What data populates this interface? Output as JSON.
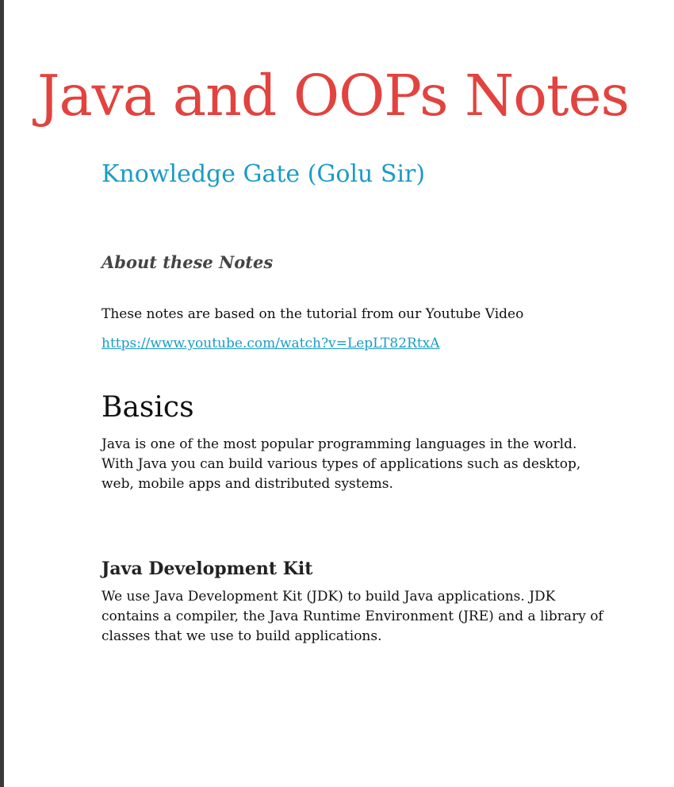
{
  "document": {
    "title": "Java and OOPs Notes",
    "subtitle": "Knowledge Gate (Golu Sir)",
    "about": {
      "heading": "About these Notes",
      "text": "These notes are based on the tutorial from our Youtube Video",
      "link": "https://www.youtube.com/watch?v=LepLT82RtxA"
    },
    "basics": {
      "heading": "Basics",
      "text": "Java is one of the most popular programming languages in the world. With Java you can build various types of applications such as desktop, web, mobile apps and distributed systems."
    },
    "jdk": {
      "heading": "Java Development Kit",
      "text": "We use Java Development Kit (JDK) to build Java applications. JDK contains a compiler, the Java Runtime Environment (JRE) and a library of classes that we use to build applications."
    }
  },
  "colors": {
    "title": "#e2433f",
    "accent": "#1a9bc6",
    "body_text": "#111111",
    "heading_gray": "#444444"
  }
}
